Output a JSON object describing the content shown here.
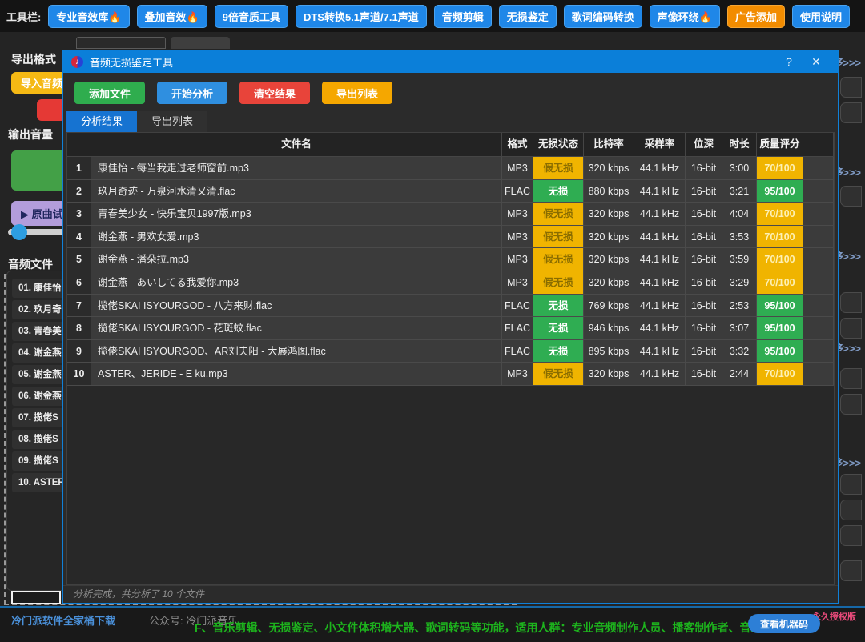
{
  "toolbar": {
    "label": "工具栏:",
    "buttons": [
      {
        "label": "专业音效库🔥",
        "style": "blue"
      },
      {
        "label": "叠加音效🔥",
        "style": "blue"
      },
      {
        "label": "9倍音质工具",
        "style": "blue"
      },
      {
        "label": "DTS转换5.1声道/7.1声道",
        "style": "blue"
      },
      {
        "label": "音频剪辑",
        "style": "blue"
      },
      {
        "label": "无损鉴定",
        "style": "blue"
      },
      {
        "label": "歌词编码转换",
        "style": "blue"
      },
      {
        "label": "声像环绕🔥",
        "style": "blue"
      },
      {
        "label": "广告添加",
        "style": "orange"
      },
      {
        "label": "使用说明",
        "style": "blue"
      }
    ]
  },
  "sidebar": {
    "export_format_label": "导出格式",
    "import_button": "导入音频",
    "output_volume_label": "输出音量",
    "play_button": "▶ 原曲试听",
    "audio_files_label": "音频文件",
    "file_list": [
      "01. 康佳怡",
      "02. 玖月奇",
      "03. 青春美",
      "04. 谢金燕",
      "05. 谢金燕",
      "06. 谢金燕",
      "07. 揽佬S",
      "08. 揽佬S",
      "09. 揽佬S",
      "10. ASTER"
    ]
  },
  "right_panel": {
    "more_label": "更多>>>"
  },
  "dialog": {
    "title": "音频无损鉴定工具",
    "icon": "music-note",
    "help_button": "?",
    "close_button": "✕",
    "action_buttons": [
      {
        "label": "添加文件",
        "color": "#2fad4e"
      },
      {
        "label": "开始分析",
        "color": "#2f8fe0"
      },
      {
        "label": "清空结果",
        "color": "#e8443a"
      },
      {
        "label": "导出列表",
        "color": "#f5a700"
      }
    ],
    "tabs": [
      {
        "label": "分析结果",
        "active": true
      },
      {
        "label": "导出列表",
        "active": false
      }
    ],
    "table": {
      "headers": [
        "",
        "文件名",
        "格式",
        "无损状态",
        "比特率",
        "采样率",
        "位深",
        "时长",
        "质量评分"
      ],
      "rows": [
        {
          "num": "1",
          "filename": "康佳怡 - 每当我走过老师窗前.mp3",
          "format": "MP3",
          "status": "假无损",
          "status_type": "fake",
          "bitrate": "320 kbps",
          "samplerate": "44.1 kHz",
          "bitdepth": "16-bit",
          "duration": "3:00",
          "score": "70/100"
        },
        {
          "num": "2",
          "filename": "玖月奇迹 - 万泉河水清又清.flac",
          "format": "FLAC",
          "status": "无损",
          "status_type": "real",
          "bitrate": "880 kbps",
          "samplerate": "44.1 kHz",
          "bitdepth": "16-bit",
          "duration": "3:21",
          "score": "95/100"
        },
        {
          "num": "3",
          "filename": "青春美少女 - 快乐宝贝1997版.mp3",
          "format": "MP3",
          "status": "假无损",
          "status_type": "fake",
          "bitrate": "320 kbps",
          "samplerate": "44.1 kHz",
          "bitdepth": "16-bit",
          "duration": "4:04",
          "score": "70/100"
        },
        {
          "num": "4",
          "filename": "谢金燕 - 男欢女爱.mp3",
          "format": "MP3",
          "status": "假无损",
          "status_type": "fake",
          "bitrate": "320 kbps",
          "samplerate": "44.1 kHz",
          "bitdepth": "16-bit",
          "duration": "3:53",
          "score": "70/100"
        },
        {
          "num": "5",
          "filename": "谢金燕 - 潘朵拉.mp3",
          "format": "MP3",
          "status": "假无损",
          "status_type": "fake",
          "bitrate": "320 kbps",
          "samplerate": "44.1 kHz",
          "bitdepth": "16-bit",
          "duration": "3:59",
          "score": "70/100"
        },
        {
          "num": "6",
          "filename": "谢金燕 - あいしてる我爱你.mp3",
          "format": "MP3",
          "status": "假无损",
          "status_type": "fake",
          "bitrate": "320 kbps",
          "samplerate": "44.1 kHz",
          "bitdepth": "16-bit",
          "duration": "3:29",
          "score": "70/100"
        },
        {
          "num": "7",
          "filename": "揽佬SKAI ISYOURGOD - 八方来财.flac",
          "format": "FLAC",
          "status": "无损",
          "status_type": "real",
          "bitrate": "769 kbps",
          "samplerate": "44.1 kHz",
          "bitdepth": "16-bit",
          "duration": "2:53",
          "score": "95/100"
        },
        {
          "num": "8",
          "filename": "揽佬SKAI ISYOURGOD - 花斑蚊.flac",
          "format": "FLAC",
          "status": "无损",
          "status_type": "real",
          "bitrate": "946 kbps",
          "samplerate": "44.1 kHz",
          "bitdepth": "16-bit",
          "duration": "3:07",
          "score": "95/100"
        },
        {
          "num": "9",
          "filename": "揽佬SKAI ISYOURGOD、AR刘夫阳 - 大展鸿图.flac",
          "format": "FLAC",
          "status": "无损",
          "status_type": "real",
          "bitrate": "895 kbps",
          "samplerate": "44.1 kHz",
          "bitdepth": "16-bit",
          "duration": "3:32",
          "score": "95/100"
        },
        {
          "num": "10",
          "filename": "ASTER、JERIDE - E ku.mp3",
          "format": "MP3",
          "status": "假无损",
          "status_type": "fake",
          "bitrate": "320 kbps",
          "samplerate": "44.1 kHz",
          "bitdepth": "16-bit",
          "duration": "2:44",
          "score": "70/100"
        }
      ]
    },
    "status_text": "分析完成，共分析了 10 个文件"
  },
  "footer": {
    "download_link": "冷门派软件全家桶下载",
    "separator": "｜",
    "wechat_label": "公众号: 冷门派音乐",
    "marquee": "F、音乐剪辑、无损鉴定、小文件体积增大器、歌词转码等功能，适用人群：专业音频制作人员、播客制作者、音乐爱",
    "machine_code_button": "查看机器码",
    "license_label": "永久授权版"
  }
}
